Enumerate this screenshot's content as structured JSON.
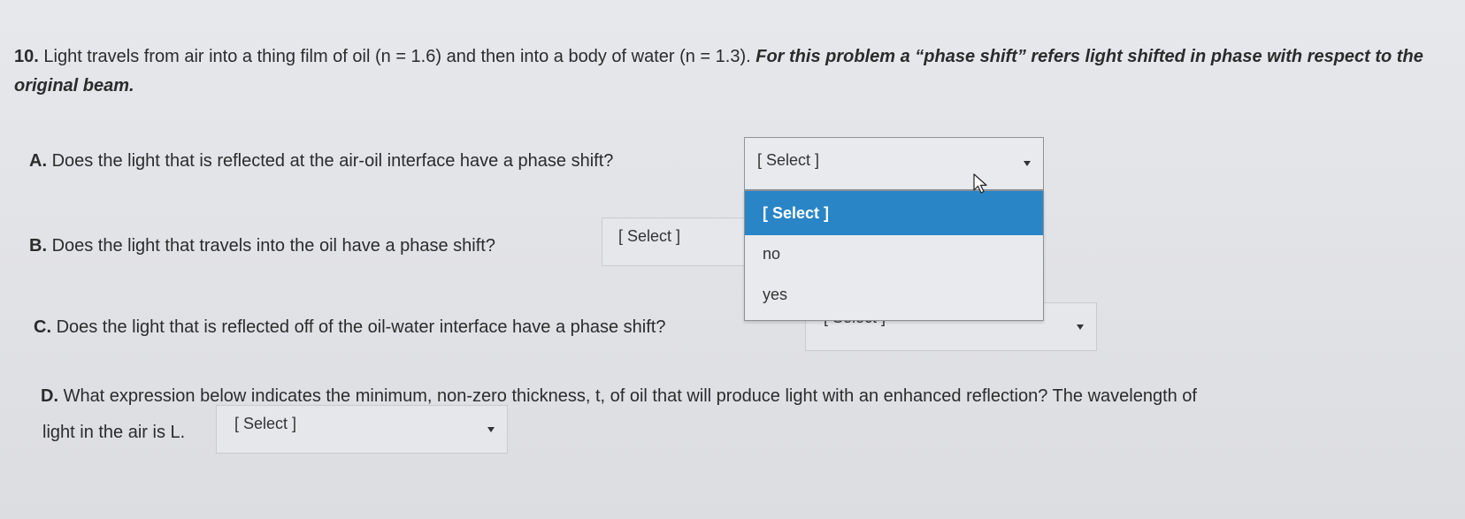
{
  "question": {
    "number": "10.",
    "text": "Light travels from air into a thing film of oil (n = 1.6) and then into a body of water (n = 1.3).",
    "note": "For this problem a “phase shift” refers light shifted in phase with respect to the original beam."
  },
  "parts": [
    {
      "letter": "A.",
      "text": "Does the light that is reflected at the air-oil interface have a phase shift?",
      "select_value": "[ Select ]"
    },
    {
      "letter": "B.",
      "text": "Does the light that travels into the oil have a phase shift?",
      "select_value": "[ Select ]"
    },
    {
      "letter": "C.",
      "text": "Does the light that is reflected off of the oil-water interface have a phase shift?",
      "select_value": "[ Select ]"
    },
    {
      "letter": "D.",
      "text": "What expression below indicates the minimum, non-zero thickness, t, of oil that will produce light with an enhanced reflection? The wavelength of",
      "text2": "light in the air is L.",
      "select_value": "[ Select ]"
    }
  ],
  "dropdown_open": {
    "options": [
      "[ Select ]",
      "no",
      "yes"
    ],
    "highlighted": "[ Select ]",
    "highlight_color": "#2a85c7"
  },
  "icons": {
    "select_arrow": "caret-down-icon",
    "cursor": "mouse-pointer-icon"
  }
}
